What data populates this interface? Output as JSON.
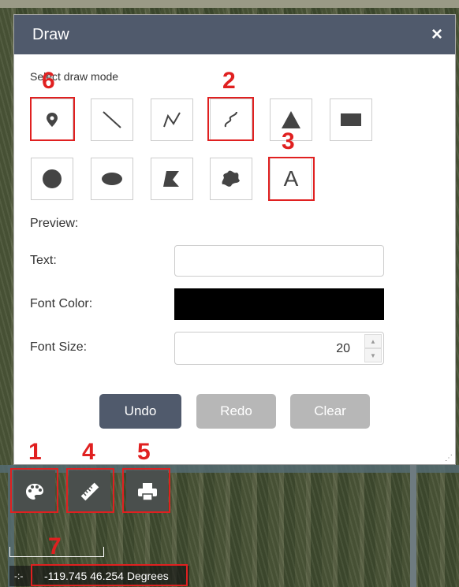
{
  "panel": {
    "title": "Draw",
    "close_label": "×",
    "mode_label": "Select draw mode",
    "preview_label": "Preview:",
    "text_label": "Text:",
    "text_value": "",
    "font_color_label": "Font Color:",
    "font_color": "#000000",
    "font_size_label": "Font Size:",
    "font_size_value": "20",
    "text_tool_glyph": "A",
    "buttons": {
      "undo": "Undo",
      "redo": "Redo",
      "clear": "Clear"
    },
    "draw_modes": [
      {
        "name": "point",
        "icon": "marker-icon"
      },
      {
        "name": "line",
        "icon": "line-icon"
      },
      {
        "name": "polyline",
        "icon": "polyline-icon"
      },
      {
        "name": "freehand-polyline",
        "icon": "freehand-line-icon"
      },
      {
        "name": "triangle",
        "icon": "triangle-icon"
      },
      {
        "name": "rectangle",
        "icon": "rectangle-icon"
      },
      {
        "name": "circle",
        "icon": "circle-icon"
      },
      {
        "name": "ellipse",
        "icon": "ellipse-icon"
      },
      {
        "name": "polygon",
        "icon": "polygon-icon"
      },
      {
        "name": "freehand-polygon",
        "icon": "freehand-polygon-icon"
      },
      {
        "name": "text",
        "icon": "text-icon"
      }
    ]
  },
  "map_tools": [
    {
      "name": "draw",
      "icon": "palette-icon"
    },
    {
      "name": "measure",
      "icon": "ruler-icon"
    },
    {
      "name": "print",
      "icon": "printer-icon"
    }
  ],
  "coordinates": "-119.745 46.254 Degrees",
  "annotations": [
    "1",
    "2",
    "3",
    "4",
    "5",
    "6",
    "7"
  ],
  "colors": {
    "header": "#505a6c",
    "annotation": "#e02020",
    "disabled_button": "#b7b7b7"
  }
}
